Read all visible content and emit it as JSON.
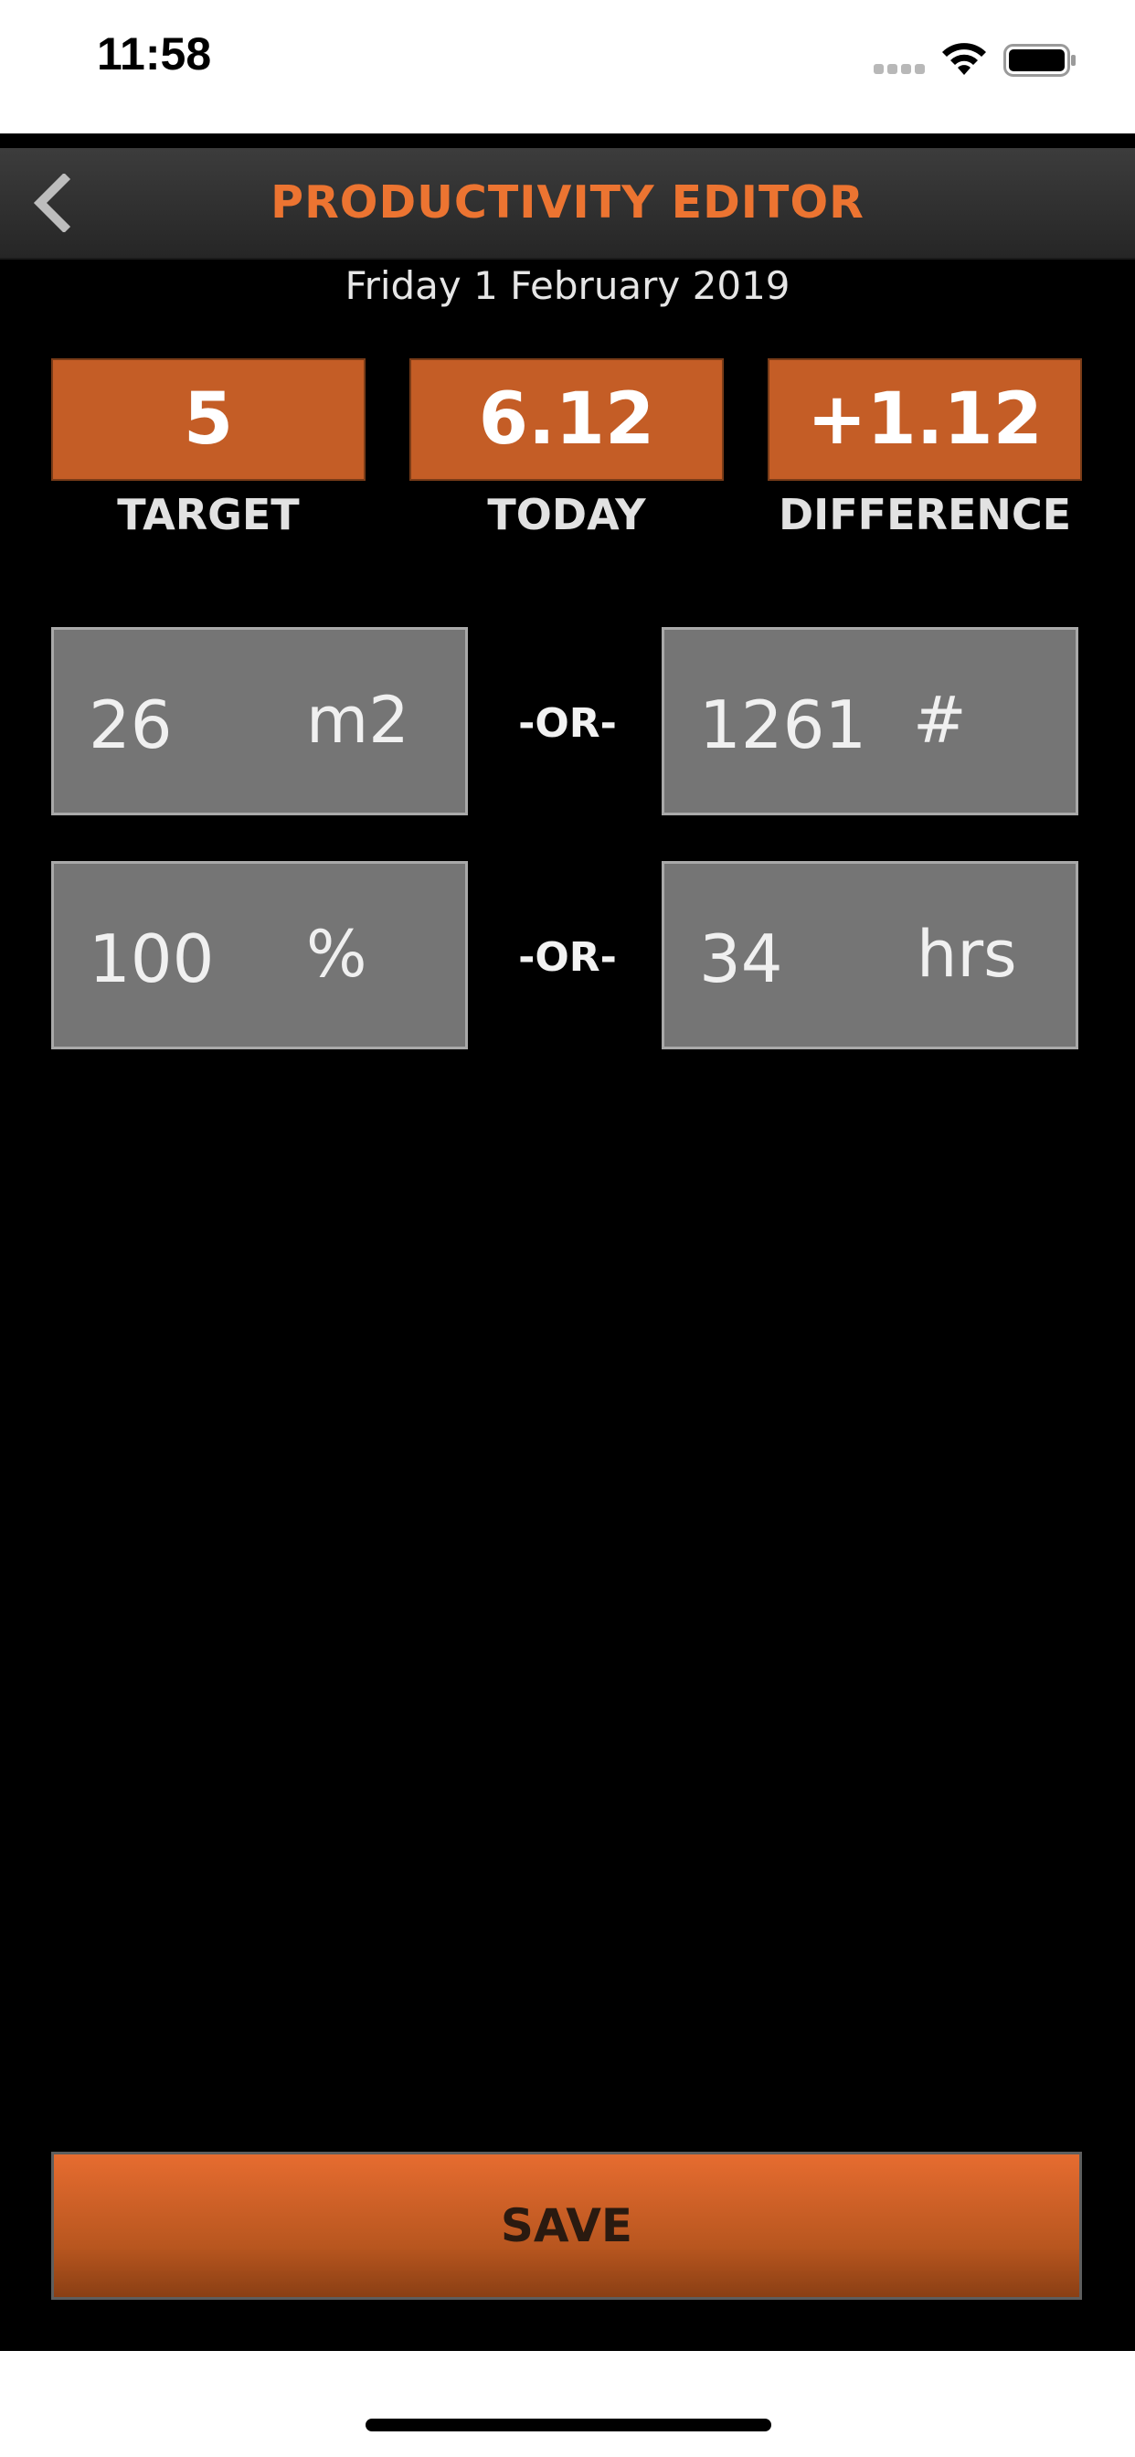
{
  "status_bar": {
    "time": "11:58"
  },
  "header": {
    "title": "PRODUCTIVITY EDITOR"
  },
  "date": "Friday 1 February 2019",
  "stats": {
    "target": {
      "value": "5",
      "label": "TARGET"
    },
    "today": {
      "value": "6.12",
      "label": "TODAY"
    },
    "difference": {
      "value": "+1.12",
      "label": "DIFFERENCE"
    }
  },
  "fields": {
    "area": {
      "value": "26",
      "unit": "m2"
    },
    "count": {
      "value": "1261",
      "unit": "#"
    },
    "percent": {
      "value": "100",
      "unit": "%"
    },
    "hours": {
      "value": "34",
      "unit": "hrs"
    }
  },
  "or_label": "-OR-",
  "save_label": "SAVE",
  "colors": {
    "accent": "#ec7431",
    "stat_box": "#c45d26",
    "field_bg": "#757575",
    "background": "#000000"
  },
  "icons": [
    "back-chevron-icon",
    "cellular-signal-icon",
    "wifi-icon",
    "battery-icon"
  ]
}
